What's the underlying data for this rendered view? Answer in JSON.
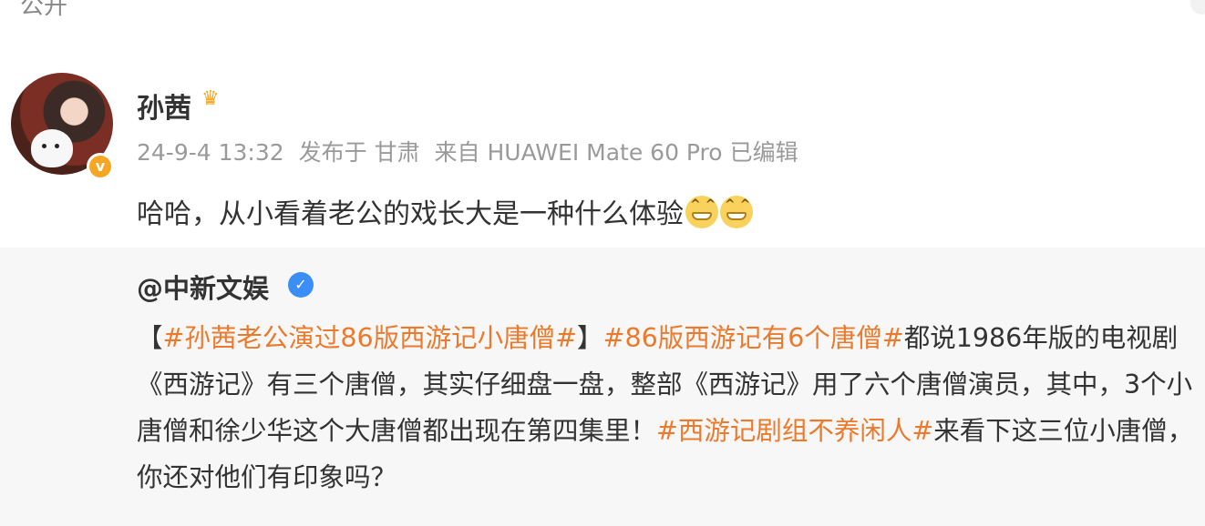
{
  "header": {
    "visibility": "公开"
  },
  "post": {
    "username": "孙茜",
    "timestamp": "24-9-4 13:32",
    "location": "发布于 甘肃",
    "device": "来自 HUAWEI Mate 60 Pro",
    "edited": "已编辑",
    "text": "哈哈，从小看着老公的戏长大是一种什么体验"
  },
  "repost": {
    "author": "@中新文娱",
    "segments": [
      {
        "text": "【",
        "type": "plain"
      },
      {
        "text": "#孙茜老公演过86版西游记小唐僧#",
        "type": "tag"
      },
      {
        "text": "】",
        "type": "plain"
      },
      {
        "text": "#86版西游记有6个唐僧#",
        "type": "tag"
      },
      {
        "text": "都说1986年版的电视剧《西游记》有三个唐僧，其实仔细盘一盘，整部《西游记》用了六个唐僧演员，其中，3个小唐僧和徐少华这个大唐僧都出现在第四集里！",
        "type": "plain"
      },
      {
        "text": "#西游记剧组不养闲人#",
        "type": "tag"
      },
      {
        "text": "来看下这三位小唐僧，你还对他们有印象吗？",
        "type": "plain"
      }
    ]
  },
  "icons": [
    "crown-icon",
    "vip-badge-icon",
    "verified-icon",
    "grin-emoji-icon"
  ],
  "colors": {
    "tag": "#ec7a2c",
    "meta": "#9a9a9a",
    "verified": "#3a8ef6",
    "vip": "#f5a623",
    "repost_bg": "#f7f7f7"
  }
}
